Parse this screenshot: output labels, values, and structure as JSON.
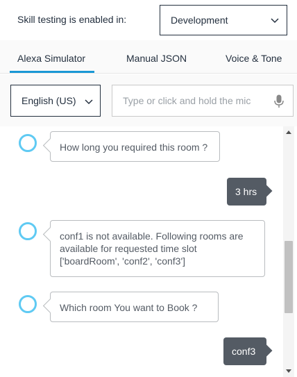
{
  "header": {
    "env_label": "Skill testing is enabled in:",
    "env_value": "Development"
  },
  "tabs": [
    {
      "label": "Alexa Simulator",
      "active": true
    },
    {
      "label": "Manual JSON",
      "active": false
    },
    {
      "label": "Voice & Tone",
      "active": false
    }
  ],
  "input": {
    "language": "English (US)",
    "utterance_placeholder": "Type or click and hold the mic",
    "utterance_value": ""
  },
  "conversation": [
    {
      "from": "alexa",
      "text": "How long you required this room ?"
    },
    {
      "from": "user",
      "text": "3 hrs"
    },
    {
      "from": "alexa",
      "lines": [
        "conf1 is not available. Following rooms are",
        "available for requested time slot",
        "['boardRoom', 'conf2', 'conf3']"
      ]
    },
    {
      "from": "alexa",
      "text": "Which room You want to Book ?"
    },
    {
      "from": "user",
      "text": "conf3"
    }
  ],
  "colors": {
    "accent": "#1a98d5",
    "avatar_ring": "#5fcaf3",
    "user_bubble": "#545b64",
    "text": "#232f3e"
  },
  "icons": [
    "chevron-down-icon",
    "microphone-icon",
    "alexa-ring-icon",
    "scroll-up-arrow",
    "scroll-down-arrow"
  ]
}
